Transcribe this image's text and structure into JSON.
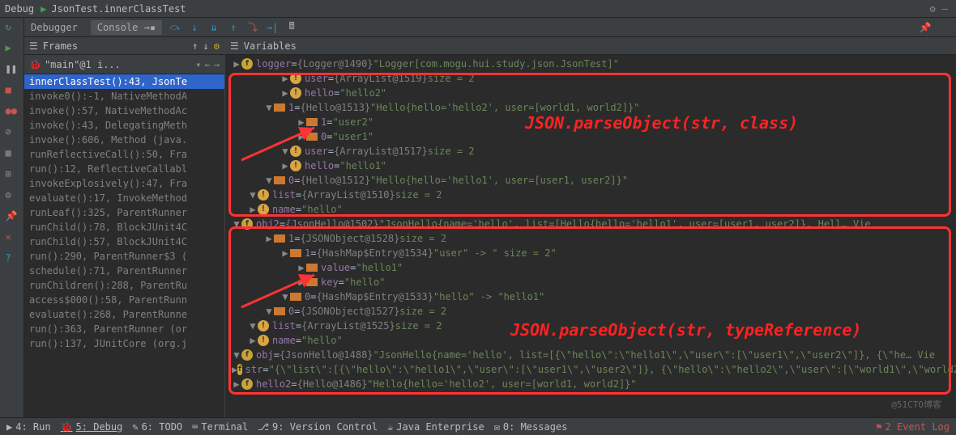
{
  "header": {
    "debug_label": "Debug",
    "title": "JsonTest.innerClassTest"
  },
  "toolbar": {
    "debugger_tab": "Debugger",
    "console_tab": "Console"
  },
  "frames": {
    "panel_title": "Frames",
    "thread": "\"main\"@1 i...",
    "stack": [
      "innerClassTest():43, JsonTe",
      "invoke0():-1, NativeMethodA",
      "invoke():57, NativeMethodAc",
      "invoke():43, DelegatingMeth",
      "invoke():606, Method (java.",
      "runReflectiveCall():50, Fra",
      "run():12, ReflectiveCallabl",
      "invokeExplosively():47, Fra",
      "evaluate():17, InvokeMethod",
      "runLeaf():325, ParentRunner",
      "runChild():78, BlockJUnit4C",
      "runChild():57, BlockJUnit4C",
      "run():290, ParentRunner$3 (",
      "schedule():71, ParentRunner",
      "runChildren():288, ParentRu",
      "access$000():58, ParentRunn",
      "evaluate():268, ParentRunne",
      "run():363, ParentRunner (or",
      "run():137, JUnitCore (org.j"
    ]
  },
  "vars": {
    "panel_title": "Variables",
    "lines": [
      {
        "indent": 0,
        "arrow": "▶",
        "icon": "fld",
        "name": "hello2",
        "eq": " = ",
        "ref": "{Hello@1486}",
        "val": " \"Hello{hello='hello2', user=[world1, world2]}\""
      },
      {
        "indent": 0,
        "arrow": "▶",
        "icon": "fld",
        "name": "str",
        "eq": " = ",
        "ref": "",
        "val": "\"{\\\"list\\\":[{\\\"hello\\\":\\\"hello1\\\",\\\"user\\\":[\\\"user1\\\",\\\"user2\\\"]}, {\\\"hello\\\":\\\"hello2\\\",\\\"user\\\":[\\\"world1\\\",\\\"world2\\\"]...  Vie"
      },
      {
        "indent": 0,
        "arrow": "▼",
        "icon": "fld",
        "name": "obj",
        "eq": " = ",
        "ref": "{JsonHello@1488}",
        "val": " \"JsonHello{name='hello', list=[{\\\"hello\\\":\\\"hello1\\\",\\\"user\\\":[\\\"user1\\\",\\\"user2\\\"]}, {\\\"he…  Vie"
      },
      {
        "indent": 1,
        "arrow": "▶",
        "icon": "warn",
        "name": "name",
        "eq": " = ",
        "ref": "",
        "val": "\"hello\""
      },
      {
        "indent": 1,
        "arrow": "▼",
        "icon": "warn",
        "name": "list",
        "eq": " = ",
        "ref": "{ArrayList@1525}",
        "val": "  size = 2"
      },
      {
        "indent": 2,
        "arrow": "▼",
        "icon": "prim",
        "name": "0",
        "eq": " = ",
        "ref": "{JSONObject@1527}",
        "val": "  size = 2"
      },
      {
        "indent": 3,
        "arrow": "▼",
        "icon": "prim",
        "name": "0",
        "eq": " = ",
        "ref": "{HashMap$Entry@1533}",
        "val": " \"hello\" -> \"hello1\""
      },
      {
        "indent": 4,
        "arrow": "▶",
        "icon": "prim",
        "name": "key",
        "eq": " = ",
        "ref": "",
        "val": "\"hello\""
      },
      {
        "indent": 4,
        "arrow": "▶",
        "icon": "prim",
        "name": "value",
        "eq": " = ",
        "ref": "",
        "val": "\"hello1\""
      },
      {
        "indent": 3,
        "arrow": "▶",
        "icon": "prim",
        "name": "1",
        "eq": " = ",
        "ref": "{HashMap$Entry@1534}",
        "val": " \"user\" -> \" size = 2\""
      },
      {
        "indent": 2,
        "arrow": "▶",
        "icon": "prim",
        "name": "1",
        "eq": " = ",
        "ref": "{JSONObject@1528}",
        "val": "  size = 2"
      },
      {
        "indent": 0,
        "arrow": "▼",
        "icon": "fld",
        "name": "obj2",
        "eq": " = ",
        "ref": "{JsonHello@1502}",
        "val": " \"JsonHello{name='hello', list=[Hello{hello='hello1', user=[user1, user2]}, Hell…  Vie"
      },
      {
        "indent": 1,
        "arrow": "▶",
        "icon": "warn",
        "name": "name",
        "eq": " = ",
        "ref": "",
        "val": "\"hello\""
      },
      {
        "indent": 1,
        "arrow": "▼",
        "icon": "warn",
        "name": "list",
        "eq": " = ",
        "ref": "{ArrayList@1510}",
        "val": "  size = 2"
      },
      {
        "indent": 2,
        "arrow": "▼",
        "icon": "prim",
        "name": "0",
        "eq": " = ",
        "ref": "{Hello@1512}",
        "val": " \"Hello{hello='hello1', user=[user1, user2]}\""
      },
      {
        "indent": 3,
        "arrow": "▶",
        "icon": "warn",
        "name": "hello",
        "eq": " = ",
        "ref": "",
        "val": "\"hello1\""
      },
      {
        "indent": 3,
        "arrow": "▼",
        "icon": "warn",
        "name": "user",
        "eq": " = ",
        "ref": "{ArrayList@1517}",
        "val": "  size = 2"
      },
      {
        "indent": 4,
        "arrow": "▶",
        "icon": "prim",
        "name": "0",
        "eq": " = ",
        "ref": "",
        "val": "\"user1\""
      },
      {
        "indent": 4,
        "arrow": "▶",
        "icon": "prim",
        "name": "1",
        "eq": " = ",
        "ref": "",
        "val": "\"user2\""
      },
      {
        "indent": 2,
        "arrow": "▼",
        "icon": "prim",
        "name": "1",
        "eq": " = ",
        "ref": "{Hello@1513}",
        "val": " \"Hello{hello='hello2', user=[world1, world2]}\""
      },
      {
        "indent": 3,
        "arrow": "▶",
        "icon": "warn",
        "name": "hello",
        "eq": " = ",
        "ref": "",
        "val": "\"hello2\""
      },
      {
        "indent": 3,
        "arrow": "▶",
        "icon": "warn",
        "name": "user",
        "eq": " = ",
        "ref": "{ArrayList@1519}",
        "val": "  size = 2"
      },
      {
        "indent": 0,
        "arrow": "▶",
        "icon": "fld",
        "name": "logger",
        "eq": " = ",
        "ref": "{Logger@1490}",
        "val": " \"Logger[com.mogu.hui.study.json.JsonTest]\""
      }
    ]
  },
  "annotations": {
    "label1": "JSON.parseObject(str, class)",
    "label2": "JSON.parseObject(str, typeReference)"
  },
  "bottom": {
    "run": "4: Run",
    "debug": "5: Debug",
    "todo": "6: TODO",
    "terminal": "Terminal",
    "vcs": "9: Version Control",
    "java_ee": "Java Enterprise",
    "messages": "0: Messages",
    "event_log": "2 Event Log"
  },
  "watermark": "@51CTO博客"
}
